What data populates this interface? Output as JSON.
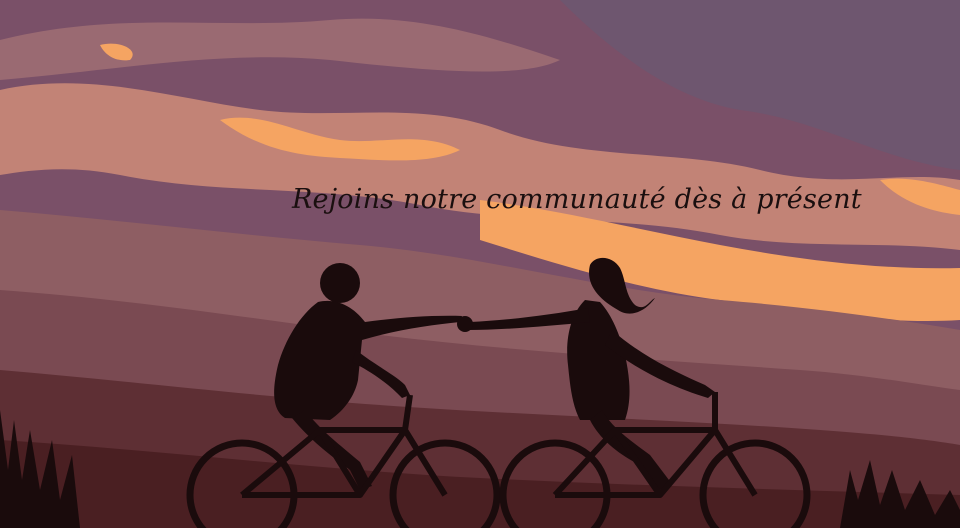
{
  "banner": {
    "headline": "Rejoins notre communauté dès à présent"
  },
  "colors": {
    "sky_top": "#7a5068",
    "sky_purple": "#6e566f",
    "cloud_mauve": "#9a6a72",
    "cloud_rose": "#c28376",
    "glow_orange": "#f5a462",
    "hill_far": "#8e5e63",
    "hill_mid": "#7a4a52",
    "hill_near": "#5e2f34",
    "ground": "#4a1f22",
    "silhouette": "#1a0b0c"
  }
}
